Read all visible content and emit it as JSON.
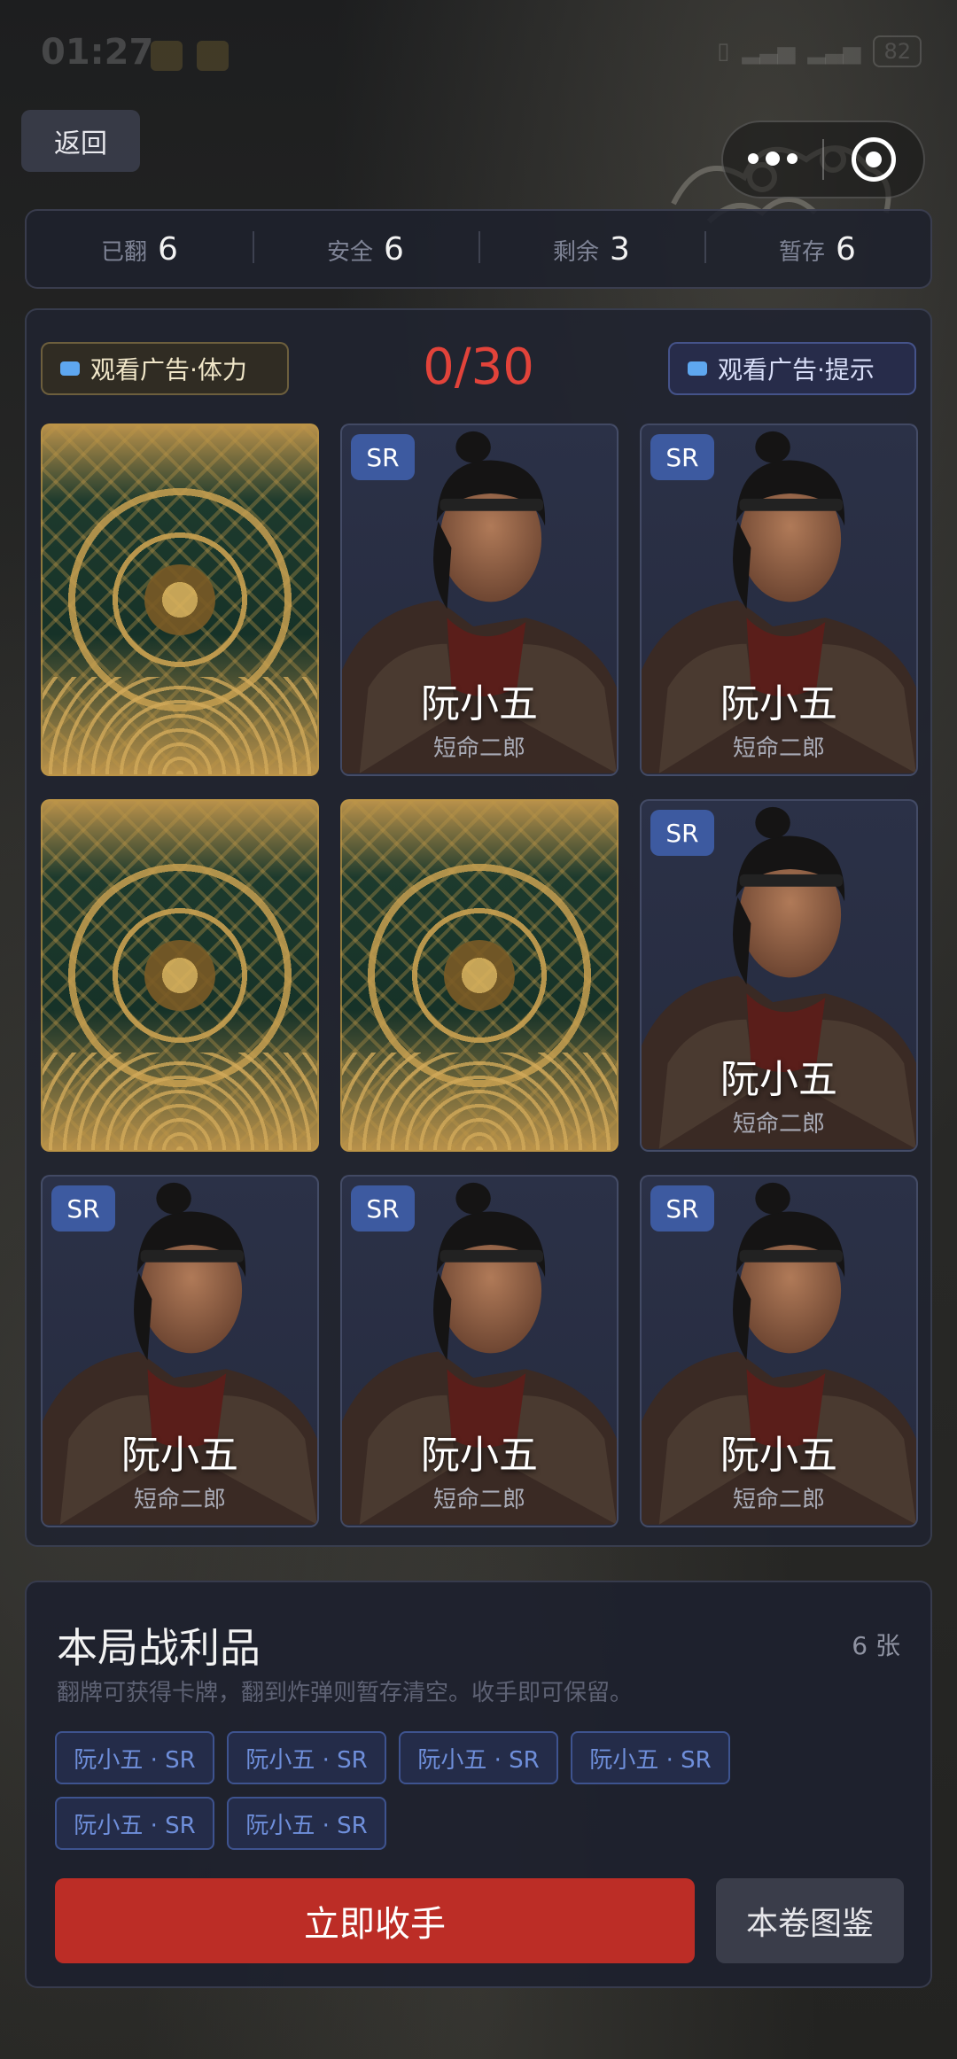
{
  "status": {
    "time": "01:27",
    "battery": "82"
  },
  "nav": {
    "back_label": "返回"
  },
  "stats": [
    {
      "label": "已翻",
      "value": "6"
    },
    {
      "label": "安全",
      "value": "6"
    },
    {
      "label": "剩余",
      "value": "3"
    },
    {
      "label": "暂存",
      "value": "6"
    }
  ],
  "board": {
    "ad_stamina_label": "观看广告·体力",
    "ad_hint_label": "观看广告·提示",
    "counter": "0/30",
    "cards": [
      {
        "state": "back"
      },
      {
        "state": "front",
        "rarity": "SR",
        "name": "阮小五",
        "title": "短命二郎"
      },
      {
        "state": "front",
        "rarity": "SR",
        "name": "阮小五",
        "title": "短命二郎"
      },
      {
        "state": "back"
      },
      {
        "state": "back"
      },
      {
        "state": "front",
        "rarity": "SR",
        "name": "阮小五",
        "title": "短命二郎"
      },
      {
        "state": "front",
        "rarity": "SR",
        "name": "阮小五",
        "title": "短命二郎"
      },
      {
        "state": "front",
        "rarity": "SR",
        "name": "阮小五",
        "title": "短命二郎"
      },
      {
        "state": "front",
        "rarity": "SR",
        "name": "阮小五",
        "title": "短命二郎"
      }
    ]
  },
  "loot": {
    "title": "本局战利品",
    "count": "6 张",
    "description": "翻牌可获得卡牌，翻到炸弹则暂存清空。收手即可保留。",
    "items": [
      "阮小五 · SR",
      "阮小五 · SR",
      "阮小五 · SR",
      "阮小五 · SR",
      "阮小五 · SR",
      "阮小五 · SR"
    ],
    "collect_label": "立即收手",
    "codex_label": "本卷图鉴"
  },
  "colors": {
    "accent_red": "#bc2d26",
    "counter_red": "#e2433a",
    "sr_badge": "#3d5aa0"
  }
}
